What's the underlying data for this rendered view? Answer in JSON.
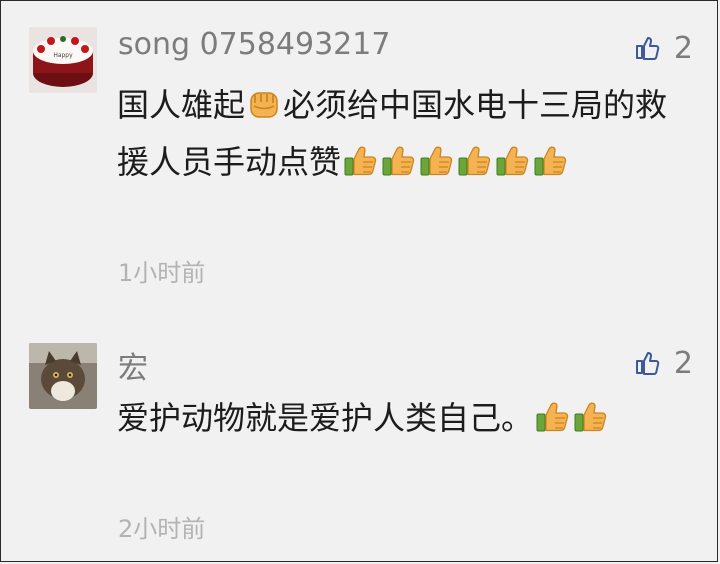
{
  "comments": [
    {
      "username": "song 0758493217",
      "text_part1": "国人雄起",
      "text_part2": "必须给中国水电十三局的救援人员手动点赞",
      "likes": "2",
      "time": "1小时前",
      "emoji_fist": "fist-emoji",
      "thumb_count": 6
    },
    {
      "username": "宏",
      "text": "爱护动物就是爱护人类自己。",
      "likes": "2",
      "time": "2小时前",
      "thumb_count": 2
    }
  ],
  "colors": {
    "background": "#f1f1f1",
    "username": "#7c7c7c",
    "body_text": "#1c1c1c",
    "timestamp": "#b3b3b3",
    "like_icon": "#3c5a99"
  },
  "icons": [
    "thumbs-up-icon",
    "thumbs-up-emoji",
    "fist-emoji"
  ]
}
